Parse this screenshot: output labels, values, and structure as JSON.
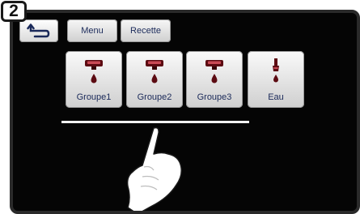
{
  "step": {
    "number": "2"
  },
  "toolbar": {
    "menu_label": "Menu",
    "recette_label": "Recette"
  },
  "groups": [
    {
      "label": "Groupe1",
      "icon": "group-head-icon"
    },
    {
      "label": "Groupe2",
      "icon": "group-head-icon"
    },
    {
      "label": "Groupe3",
      "icon": "group-head-icon"
    },
    {
      "label": "Eau",
      "icon": "water-tap-icon"
    }
  ],
  "colors": {
    "screen_bg": "#050505",
    "button_text": "#1b2a5a",
    "icon_dark_red": "#5c0b12",
    "underline": "#f2f2f2"
  }
}
